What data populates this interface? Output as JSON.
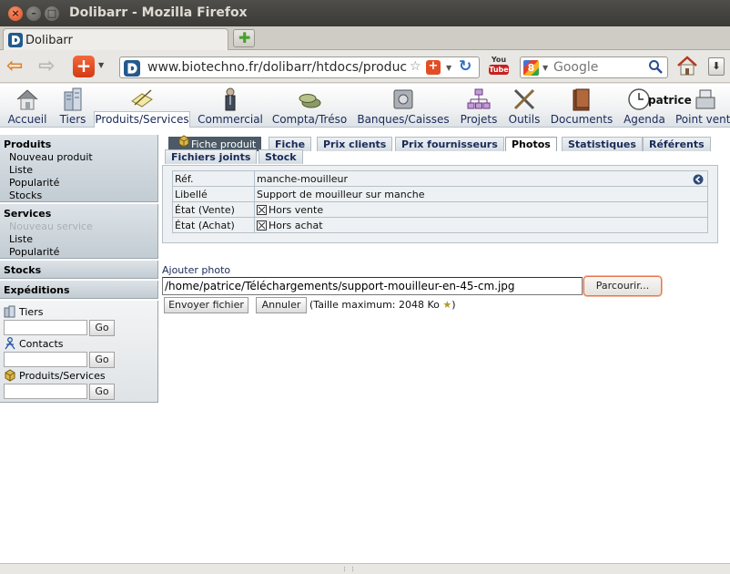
{
  "window": {
    "title": "Dolibarr - Mozilla Firefox"
  },
  "browser": {
    "tab_label": "Dolibarr",
    "url": "www.biotechno.fr/dolibarr/htdocs/produc",
    "search_placeholder": "Google",
    "youtube_top": "You",
    "youtube_bottom": "Tube"
  },
  "topmenu": {
    "items": [
      {
        "label": "Accueil"
      },
      {
        "label": "Tiers"
      },
      {
        "label": "Produits/Services"
      },
      {
        "label": "Commercial"
      },
      {
        "label": "Compta/Tréso"
      },
      {
        "label": "Banques/Caisses"
      },
      {
        "label": "Projets"
      },
      {
        "label": "Outils"
      },
      {
        "label": "Documents"
      },
      {
        "label": "Agenda"
      },
      {
        "label": "Point vente"
      }
    ],
    "user": "patrice"
  },
  "leftmenu": {
    "produits": {
      "title": "Produits",
      "items": [
        "Nouveau produit",
        "Liste",
        "Popularité",
        "Stocks"
      ]
    },
    "services": {
      "title": "Services",
      "items": [
        "Nouveau service",
        "Liste",
        "Popularité"
      ]
    },
    "stocks": {
      "title": "Stocks"
    },
    "expeditions": {
      "title": "Expéditions"
    },
    "search": {
      "tiers_label": "Tiers",
      "contacts_label": "Contacts",
      "produits_label": "Produits/Services",
      "go_label": "Go"
    }
  },
  "tabs": {
    "head": "Fiche produit",
    "items": [
      "Fiche",
      "Prix clients",
      "Prix fournisseurs",
      "Photos",
      "Statistiques",
      "Référents",
      "Fichiers joints",
      "Stock"
    ]
  },
  "fiche": {
    "rows": [
      {
        "label": "Réf.",
        "value": "manche-mouilleur"
      },
      {
        "label": "Libellé",
        "value": "Support de mouilleur sur manche"
      },
      {
        "label": "État (Vente)",
        "value": "Hors vente"
      },
      {
        "label": "État (Achat)",
        "value": "Hors achat"
      }
    ]
  },
  "upload": {
    "title": "Ajouter photo",
    "file_path": "/home/patrice/Téléchargements/support-mouilleur-en-45-cm.jpg",
    "browse_label": "Parcourir...",
    "send_label": "Envoyer fichier",
    "cancel_label": "Annuler",
    "max_size_text": "(Taille maximum: 2048 Ko",
    "max_size_close": ")"
  },
  "colors": {
    "titlebar": "#3c3b37",
    "menu_text": "#1a2a5a",
    "left_menu_bg": "#c2ccd3",
    "tab_head_bg": "#4b5a66",
    "browse_border": "#e4784c"
  }
}
